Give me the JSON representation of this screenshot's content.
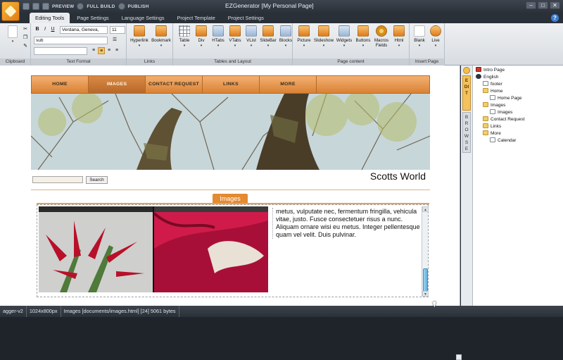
{
  "window": {
    "title": "EZGenerator  [My Personal Page]",
    "qat": {
      "preview": "PREVIEW",
      "full_build": "FULL BUILD",
      "publish": "PUBLISH"
    },
    "controls": [
      "–",
      "□",
      "✕"
    ]
  },
  "ribbon_tabs": [
    "Editing Tools",
    "Page Settings",
    "Language Settings",
    "Project Template",
    "Project Settings"
  ],
  "ribbon": {
    "groups": {
      "clipboard": "Clipboard",
      "text_format": "Text Format",
      "links": "Links",
      "tables_layout": "Tables and Layout",
      "page_content": "Page content",
      "insert_page": "Insert Page"
    },
    "font_name": "Verdana, Geneva,",
    "font_size": "11",
    "style": "sub",
    "format_buttons": [
      "B",
      "I",
      "U"
    ],
    "buttons": {
      "hyperlink": "Hyperlink",
      "bookmark": "Bookmark",
      "table": "Table",
      "div": "Div",
      "htabs": "HTabs",
      "vtabs": "VTabs",
      "vlist": "VList",
      "slidebar": "SlideBar",
      "blocks": "Blocks",
      "picture": "Picture",
      "slideshow": "Slideshow",
      "widgets": "Widgets",
      "buttons": "Buttons",
      "macros": "Macros",
      "fields": "Fields",
      "html": "Html",
      "blank": "Blank",
      "live": "Live"
    }
  },
  "site": {
    "nav": [
      "HOME",
      "IMAGES",
      "CONTACT REQUEST",
      "LINKS",
      "MORE"
    ],
    "active_nav": 1,
    "title": "Scotts World",
    "search_label": "Search",
    "page_tab": "Images",
    "body_text": "metus, vulputate nec, fermentum fringilla, vehicula vitae, justo. Fusce consectetuer risus a nunc. Aliquam ornare wisi eu metus. Integer pellentesque quam vel velit. Duis pulvinar."
  },
  "side_tabs": {
    "edit": "EDIT",
    "browse": "BROWSE"
  },
  "tree": [
    {
      "label": "Intro Page",
      "level": 0,
      "icon": "red"
    },
    {
      "label": "English",
      "level": 0,
      "icon": "globe"
    },
    {
      "label": "footer",
      "level": 1,
      "icon": "pg"
    },
    {
      "label": "Home",
      "level": 1,
      "icon": "folder"
    },
    {
      "label": "Home Page",
      "level": 2,
      "icon": "pg"
    },
    {
      "label": "Images",
      "level": 1,
      "icon": "folder"
    },
    {
      "label": "Images",
      "level": 2,
      "icon": "pg"
    },
    {
      "label": "Contact Request",
      "level": 1,
      "icon": "folder"
    },
    {
      "label": "Links",
      "level": 1,
      "icon": "folder"
    },
    {
      "label": "More",
      "level": 1,
      "icon": "folder"
    },
    {
      "label": "Calendar",
      "level": 2,
      "icon": "pg"
    }
  ],
  "status": {
    "template": "agger-v2",
    "resolution": "1024x800px",
    "file": "Images [documents/images.html] [24] 5061 bytes"
  },
  "colors": {
    "accent": "#e48a30",
    "nav": "#d98234",
    "chrome": "#2a3038"
  }
}
